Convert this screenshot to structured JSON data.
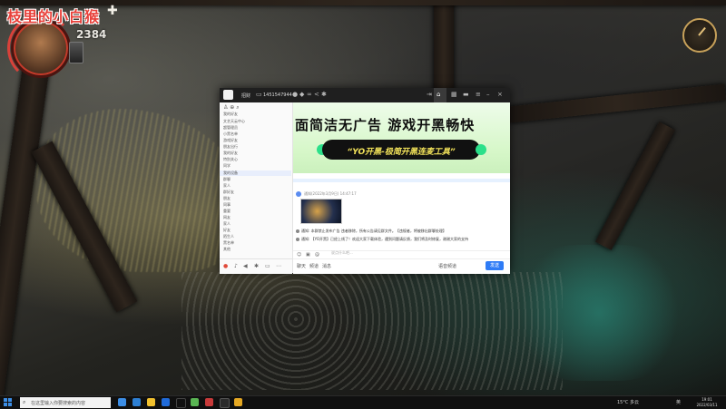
{
  "hud": {
    "streamer_name": "枝里的小白猴",
    "score": "2384",
    "bone_icon": "bone-icon",
    "compass_icon": "compass-icon"
  },
  "qq_window": {
    "title": "招财",
    "group_id": "1451547944",
    "sidebar": {
      "header": "我的好友",
      "rows": [
        "文艺天云中心",
        "超管理员",
        "小黑名单",
        "游戏好友",
        "朋友出行",
        "我的好友",
        "特别关心",
        "同学",
        "我的设备",
        "群聊",
        "家人",
        "群好友",
        "朋友",
        "同事",
        "重要",
        "网友",
        "家人",
        "好友",
        "陌生人",
        "黑名单",
        "其他"
      ],
      "selected_row": "群聊"
    },
    "banner": {
      "headline": "面简洁无广告 游戏开黑畅快",
      "pill_text": "“YO开黑-极简开黑连麦工具”"
    },
    "message": {
      "meta": "通知(2022年3月9日) 14:47:17",
      "notice1": "通知: 本群禁止发布广告 违者移除，所有公告请见群文件。【违规者，将被移出群聊处理】",
      "notice2": "通知: 【YO开黑】已经上线了！欢迎大家下载体验，遇到问题请反馈，我们将及时修复，谢谢大家的支持"
    },
    "input": {
      "placeholder": "说点什么吧..."
    },
    "bottom": {
      "items": [
        "聊天",
        "频道",
        "消息"
      ],
      "voice_label": "语音频道",
      "send_label": "发送"
    }
  },
  "taskbar": {
    "search_placeholder": "在这里输入你要搜索的内容",
    "weather": "15°C 多云",
    "lang": "英",
    "time": "19:01",
    "date": "2022/03/11"
  }
}
